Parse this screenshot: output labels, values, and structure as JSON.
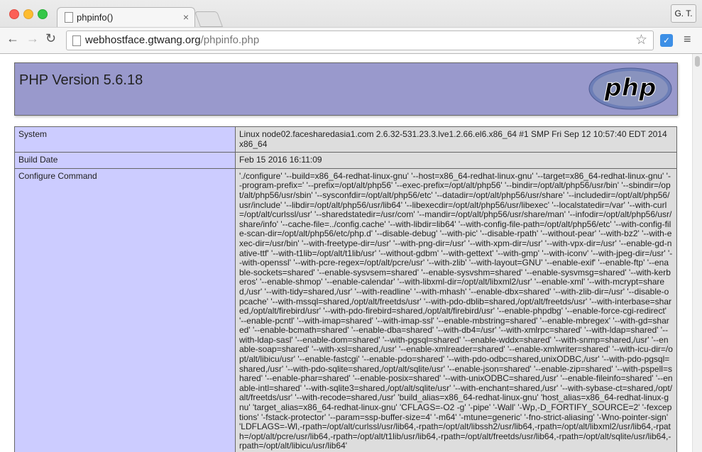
{
  "browser": {
    "tab_title": "phpinfo()",
    "tab_close": "×",
    "profile_label": "G. T.",
    "url_host": "webhostface.gtwang.org",
    "url_path": "/phpinfo.php"
  },
  "header": {
    "title": "PHP Version 5.6.18",
    "logo_text": "php"
  },
  "rows": [
    {
      "key": "System",
      "value": "Linux node02.facesharedasia1.com 2.6.32-531.23.3.lve1.2.66.el6.x86_64 #1 SMP Fri Sep 12 10:57:40 EDT 2014 x86_64"
    },
    {
      "key": "Build Date",
      "value": "Feb 15 2016 16:11:09"
    },
    {
      "key": "Configure Command",
      "value": "'./configure' '--build=x86_64-redhat-linux-gnu' '--host=x86_64-redhat-linux-gnu' '--target=x86_64-redhat-linux-gnu' '--program-prefix=' '--prefix=/opt/alt/php56' '--exec-prefix=/opt/alt/php56' '--bindir=/opt/alt/php56/usr/bin' '--sbindir=/opt/alt/php56/usr/sbin' '--sysconfdir=/opt/alt/php56/etc' '--datadir=/opt/alt/php56/usr/share' '--includedir=/opt/alt/php56/usr/include' '--libdir=/opt/alt/php56/usr/lib64' '--libexecdir=/opt/alt/php56/usr/libexec' '--localstatedir=/var' '--with-curl=/opt/alt/curlssl/usr' '--sharedstatedir=/usr/com' '--mandir=/opt/alt/php56/usr/share/man' '--infodir=/opt/alt/php56/usr/share/info' '--cache-file=../config.cache' '--with-libdir=lib64' '--with-config-file-path=/opt/alt/php56/etc' '--with-config-file-scan-dir=/opt/alt/php56/etc/php.d' '--disable-debug' '--with-pic' '--disable-rpath' '--without-pear' '--with-bz2' '--with-exec-dir=/usr/bin' '--with-freetype-dir=/usr' '--with-png-dir=/usr' '--with-xpm-dir=/usr' '--with-vpx-dir=/usr' '--enable-gd-native-ttf' '--with-t1lib=/opt/alt/t1lib/usr' '--without-gdbm' '--with-gettext' '--with-gmp' '--with-iconv' '--with-jpeg-dir=/usr' '--with-openssl' '--with-pcre-regex=/opt/alt/pcre/usr' '--with-zlib' '--with-layout=GNU' '--enable-exif' '--enable-ftp' '--enable-sockets=shared' '--enable-sysvsem=shared' '--enable-sysvshm=shared' '--enable-sysvmsg=shared' '--with-kerberos' '--enable-shmop' '--enable-calendar' '--with-libxml-dir=/opt/alt/libxml2/usr' '--enable-xml' '--with-mcrypt=shared,/usr' '--with-tidy=shared,/usr' '--with-readline' '--with-mhash' '--enable-dbx=shared' '--with-zlib-dir=/usr' '--disable-opcache' '--with-mssql=shared,/opt/alt/freetds/usr' '--with-pdo-dblib=shared,/opt/alt/freetds/usr' '--with-interbase=shared,/opt/alt/firebird/usr' '--with-pdo-firebird=shared,/opt/alt/firebird/usr' '--enable-phpdbg' '--enable-force-cgi-redirect' '--enable-pcntl' '--with-imap=shared' '--with-imap-ssl' '--enable-mbstring=shared' '--enable-mbregex' '--with-gd=shared' '--enable-bcmath=shared' '--enable-dba=shared' '--with-db4=/usr' '--with-xmlrpc=shared' '--with-ldap=shared' '--with-ldap-sasl' '--enable-dom=shared' '--with-pgsql=shared' '--enable-wddx=shared' '--with-snmp=shared,/usr' '--enable-soap=shared' '--with-xsl=shared,/usr' '--enable-xmlreader=shared' '--enable-xmlwriter=shared' '--with-icu-dir=/opt/alt/libicu/usr' '--enable-fastcgi' '--enable-pdo=shared' '--with-pdo-odbc=shared,unixODBC,/usr' '--with-pdo-pgsql=shared,/usr' '--with-pdo-sqlite=shared,/opt/alt/sqlite/usr' '--enable-json=shared' '--enable-zip=shared' '--with-pspell=shared' '--enable-phar=shared' '--enable-posix=shared' '--with-unixODBC=shared,/usr' '--enable-fileinfo=shared' '--enable-intl=shared' '--with-sqlite3=shared,/opt/alt/sqlite/usr' '--with-enchant=shared,/usr' '--with-sybase-ct=shared,/opt/alt/freetds/usr' '--with-recode=shared,/usr' 'build_alias=x86_64-redhat-linux-gnu' 'host_alias=x86_64-redhat-linux-gnu' 'target_alias=x86_64-redhat-linux-gnu' 'CFLAGS=-O2 -g' '-pipe' '-Wall' '-Wp,-D_FORTIFY_SOURCE=2' '-fexceptions' '-fstack-protector' '--param=ssp-buffer-size=4' '-m64' '-mtune=generic' '-fno-strict-aliasing' '-Wno-pointer-sign' 'LDFLAGS=-Wl,-rpath=/opt/alt/curlssl/usr/lib64,-rpath=/opt/alt/libssh2/usr/lib64,-rpath=/opt/alt/libxml2/usr/lib64,-rpath=/opt/alt/pcre/usr/lib64,-rpath=/opt/alt/t1lib/usr/lib64,-rpath=/opt/alt/freetds/usr/lib64,-rpath=/opt/alt/sqlite/usr/lib64,-rpath=/opt/alt/libicu/usr/lib64'"
    }
  ]
}
